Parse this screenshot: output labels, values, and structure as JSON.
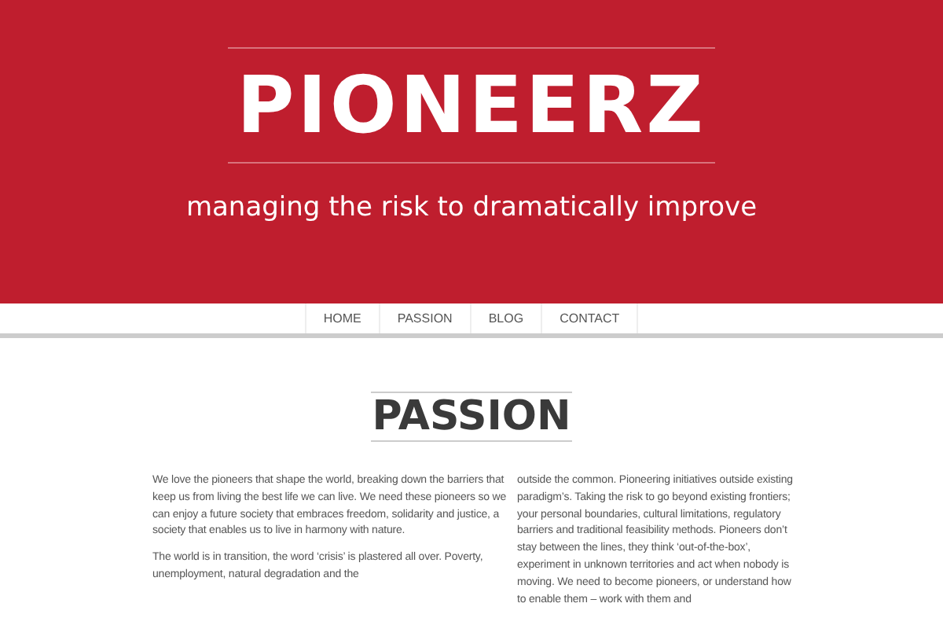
{
  "header": {
    "title": "PIONEERZ",
    "tagline": "managing the risk to dramatically improve"
  },
  "nav": [
    {
      "label": "HOME",
      "selected": false
    },
    {
      "label": "PASSION",
      "selected": false
    },
    {
      "label": "BLOG",
      "selected": false
    },
    {
      "label": "CONTACT",
      "selected": false
    }
  ],
  "section": {
    "heading": "PASSION",
    "column_1": [
      "We love the pioneers that shape the world, breaking down the barriers that keep us from living the best life we can live. We need these pioneers so we can enjoy a future society that embraces freedom, solidarity and justice, a society that enables us to live in harmony with nature.",
      "The world is in transition, the word ‘crisis’ is plastered all over. Poverty, unemployment, natural degradation and the"
    ],
    "column_2": [
      "outside the common. Pioneering initiatives outside existing paradigm’s. Taking the risk to go beyond existing frontiers; your personal boundaries, cultural limitations, regulatory barriers and traditional feasibility methods. Pioneers don’t stay between the lines, they think ‘out-of-the-box’, experiment in unknown territories and act when nobody is moving. We need to become pioneers, or understand how to enable them – work with them and"
    ]
  }
}
